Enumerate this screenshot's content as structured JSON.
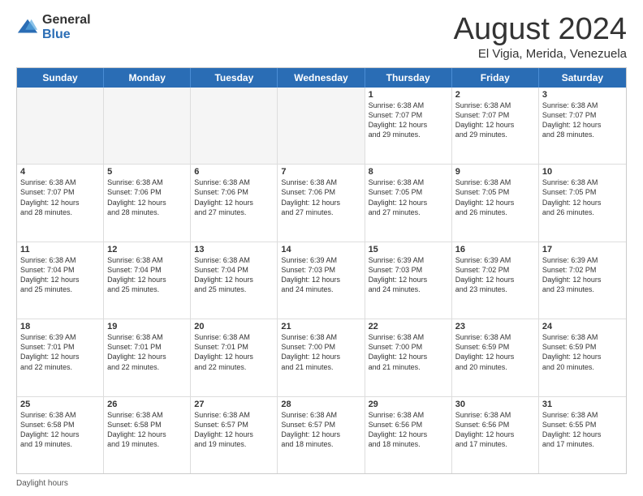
{
  "logo": {
    "general": "General",
    "blue": "Blue"
  },
  "header": {
    "month_year": "August 2024",
    "location": "El Vigia, Merida, Venezuela"
  },
  "weekdays": [
    "Sunday",
    "Monday",
    "Tuesday",
    "Wednesday",
    "Thursday",
    "Friday",
    "Saturday"
  ],
  "footer": {
    "label": "Daylight hours"
  },
  "rows": [
    [
      {
        "day": "",
        "empty": true,
        "lines": []
      },
      {
        "day": "",
        "empty": true,
        "lines": []
      },
      {
        "day": "",
        "empty": true,
        "lines": []
      },
      {
        "day": "",
        "empty": true,
        "lines": []
      },
      {
        "day": "1",
        "empty": false,
        "lines": [
          "Sunrise: 6:38 AM",
          "Sunset: 7:07 PM",
          "Daylight: 12 hours",
          "and 29 minutes."
        ]
      },
      {
        "day": "2",
        "empty": false,
        "lines": [
          "Sunrise: 6:38 AM",
          "Sunset: 7:07 PM",
          "Daylight: 12 hours",
          "and 29 minutes."
        ]
      },
      {
        "day": "3",
        "empty": false,
        "lines": [
          "Sunrise: 6:38 AM",
          "Sunset: 7:07 PM",
          "Daylight: 12 hours",
          "and 28 minutes."
        ]
      }
    ],
    [
      {
        "day": "4",
        "empty": false,
        "lines": [
          "Sunrise: 6:38 AM",
          "Sunset: 7:07 PM",
          "Daylight: 12 hours",
          "and 28 minutes."
        ]
      },
      {
        "day": "5",
        "empty": false,
        "lines": [
          "Sunrise: 6:38 AM",
          "Sunset: 7:06 PM",
          "Daylight: 12 hours",
          "and 28 minutes."
        ]
      },
      {
        "day": "6",
        "empty": false,
        "lines": [
          "Sunrise: 6:38 AM",
          "Sunset: 7:06 PM",
          "Daylight: 12 hours",
          "and 27 minutes."
        ]
      },
      {
        "day": "7",
        "empty": false,
        "lines": [
          "Sunrise: 6:38 AM",
          "Sunset: 7:06 PM",
          "Daylight: 12 hours",
          "and 27 minutes."
        ]
      },
      {
        "day": "8",
        "empty": false,
        "lines": [
          "Sunrise: 6:38 AM",
          "Sunset: 7:05 PM",
          "Daylight: 12 hours",
          "and 27 minutes."
        ]
      },
      {
        "day": "9",
        "empty": false,
        "lines": [
          "Sunrise: 6:38 AM",
          "Sunset: 7:05 PM",
          "Daylight: 12 hours",
          "and 26 minutes."
        ]
      },
      {
        "day": "10",
        "empty": false,
        "lines": [
          "Sunrise: 6:38 AM",
          "Sunset: 7:05 PM",
          "Daylight: 12 hours",
          "and 26 minutes."
        ]
      }
    ],
    [
      {
        "day": "11",
        "empty": false,
        "lines": [
          "Sunrise: 6:38 AM",
          "Sunset: 7:04 PM",
          "Daylight: 12 hours",
          "and 25 minutes."
        ]
      },
      {
        "day": "12",
        "empty": false,
        "lines": [
          "Sunrise: 6:38 AM",
          "Sunset: 7:04 PM",
          "Daylight: 12 hours",
          "and 25 minutes."
        ]
      },
      {
        "day": "13",
        "empty": false,
        "lines": [
          "Sunrise: 6:38 AM",
          "Sunset: 7:04 PM",
          "Daylight: 12 hours",
          "and 25 minutes."
        ]
      },
      {
        "day": "14",
        "empty": false,
        "lines": [
          "Sunrise: 6:39 AM",
          "Sunset: 7:03 PM",
          "Daylight: 12 hours",
          "and 24 minutes."
        ]
      },
      {
        "day": "15",
        "empty": false,
        "lines": [
          "Sunrise: 6:39 AM",
          "Sunset: 7:03 PM",
          "Daylight: 12 hours",
          "and 24 minutes."
        ]
      },
      {
        "day": "16",
        "empty": false,
        "lines": [
          "Sunrise: 6:39 AM",
          "Sunset: 7:02 PM",
          "Daylight: 12 hours",
          "and 23 minutes."
        ]
      },
      {
        "day": "17",
        "empty": false,
        "lines": [
          "Sunrise: 6:39 AM",
          "Sunset: 7:02 PM",
          "Daylight: 12 hours",
          "and 23 minutes."
        ]
      }
    ],
    [
      {
        "day": "18",
        "empty": false,
        "lines": [
          "Sunrise: 6:39 AM",
          "Sunset: 7:01 PM",
          "Daylight: 12 hours",
          "and 22 minutes."
        ]
      },
      {
        "day": "19",
        "empty": false,
        "lines": [
          "Sunrise: 6:38 AM",
          "Sunset: 7:01 PM",
          "Daylight: 12 hours",
          "and 22 minutes."
        ]
      },
      {
        "day": "20",
        "empty": false,
        "lines": [
          "Sunrise: 6:38 AM",
          "Sunset: 7:01 PM",
          "Daylight: 12 hours",
          "and 22 minutes."
        ]
      },
      {
        "day": "21",
        "empty": false,
        "lines": [
          "Sunrise: 6:38 AM",
          "Sunset: 7:00 PM",
          "Daylight: 12 hours",
          "and 21 minutes."
        ]
      },
      {
        "day": "22",
        "empty": false,
        "lines": [
          "Sunrise: 6:38 AM",
          "Sunset: 7:00 PM",
          "Daylight: 12 hours",
          "and 21 minutes."
        ]
      },
      {
        "day": "23",
        "empty": false,
        "lines": [
          "Sunrise: 6:38 AM",
          "Sunset: 6:59 PM",
          "Daylight: 12 hours",
          "and 20 minutes."
        ]
      },
      {
        "day": "24",
        "empty": false,
        "lines": [
          "Sunrise: 6:38 AM",
          "Sunset: 6:59 PM",
          "Daylight: 12 hours",
          "and 20 minutes."
        ]
      }
    ],
    [
      {
        "day": "25",
        "empty": false,
        "lines": [
          "Sunrise: 6:38 AM",
          "Sunset: 6:58 PM",
          "Daylight: 12 hours",
          "and 19 minutes."
        ]
      },
      {
        "day": "26",
        "empty": false,
        "lines": [
          "Sunrise: 6:38 AM",
          "Sunset: 6:58 PM",
          "Daylight: 12 hours",
          "and 19 minutes."
        ]
      },
      {
        "day": "27",
        "empty": false,
        "lines": [
          "Sunrise: 6:38 AM",
          "Sunset: 6:57 PM",
          "Daylight: 12 hours",
          "and 19 minutes."
        ]
      },
      {
        "day": "28",
        "empty": false,
        "lines": [
          "Sunrise: 6:38 AM",
          "Sunset: 6:57 PM",
          "Daylight: 12 hours",
          "and 18 minutes."
        ]
      },
      {
        "day": "29",
        "empty": false,
        "lines": [
          "Sunrise: 6:38 AM",
          "Sunset: 6:56 PM",
          "Daylight: 12 hours",
          "and 18 minutes."
        ]
      },
      {
        "day": "30",
        "empty": false,
        "lines": [
          "Sunrise: 6:38 AM",
          "Sunset: 6:56 PM",
          "Daylight: 12 hours",
          "and 17 minutes."
        ]
      },
      {
        "day": "31",
        "empty": false,
        "lines": [
          "Sunrise: 6:38 AM",
          "Sunset: 6:55 PM",
          "Daylight: 12 hours",
          "and 17 minutes."
        ]
      }
    ]
  ]
}
